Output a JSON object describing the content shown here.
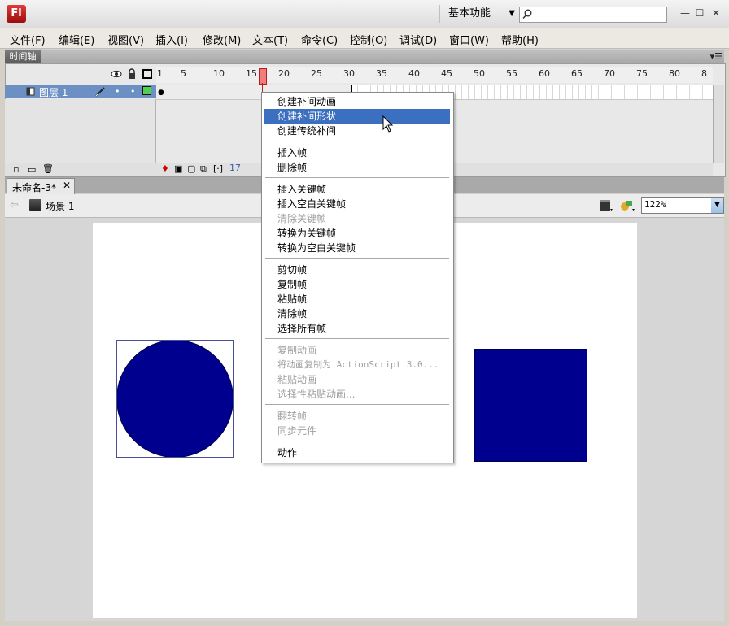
{
  "app": {
    "logo": "Fl",
    "workspace": "基本功能",
    "search_placeholder": ""
  },
  "menubar": [
    {
      "label": "文件(F)"
    },
    {
      "label": "编辑(E)"
    },
    {
      "label": "视图(V)"
    },
    {
      "label": "插入(I)"
    },
    {
      "label": "修改(M)"
    },
    {
      "label": "文本(T)"
    },
    {
      "label": "命令(C)"
    },
    {
      "label": "控制(O)"
    },
    {
      "label": "调试(D)"
    },
    {
      "label": "窗口(W)"
    },
    {
      "label": "帮助(H)"
    }
  ],
  "timeline": {
    "tab_label": "时间轴",
    "layer_name": "图层 1",
    "ruler_ticks": [
      "1",
      "5",
      "10",
      "15",
      "20",
      "25",
      "30",
      "35",
      "40",
      "45",
      "50",
      "55",
      "60",
      "65",
      "70",
      "75",
      "80",
      "8"
    ],
    "current_frame": "17",
    "playhead_frame": 17
  },
  "document": {
    "tab_title": "未命名-3*",
    "scene_label": "场景 1",
    "zoom": "122%"
  },
  "stage": {
    "fill_color": "#00008f",
    "background": "#ffffff"
  },
  "context_menu": {
    "groups": [
      [
        {
          "label": "创建补间动画",
          "enabled": true
        },
        {
          "label": "创建补间形状",
          "enabled": true,
          "highlighted": true
        },
        {
          "label": "创建传统补间",
          "enabled": true
        }
      ],
      [
        {
          "label": "插入帧",
          "enabled": true
        },
        {
          "label": "删除帧",
          "enabled": true
        }
      ],
      [
        {
          "label": "插入关键帧",
          "enabled": true
        },
        {
          "label": "插入空白关键帧",
          "enabled": true
        },
        {
          "label": "清除关键帧",
          "enabled": false
        },
        {
          "label": "转换为关键帧",
          "enabled": true
        },
        {
          "label": "转换为空白关键帧",
          "enabled": true
        }
      ],
      [
        {
          "label": "剪切帧",
          "enabled": true
        },
        {
          "label": "复制帧",
          "enabled": true
        },
        {
          "label": "粘贴帧",
          "enabled": true
        },
        {
          "label": "清除帧",
          "enabled": true
        },
        {
          "label": "选择所有帧",
          "enabled": true
        }
      ],
      [
        {
          "label": "复制动画",
          "enabled": false
        },
        {
          "label": "将动画复制为 ActionScript 3.0...",
          "enabled": false
        },
        {
          "label": "粘贴动画",
          "enabled": false
        },
        {
          "label": "选择性粘贴动画...",
          "enabled": false
        }
      ],
      [
        {
          "label": "翻转帧",
          "enabled": false
        },
        {
          "label": "同步元件",
          "enabled": false
        }
      ],
      [
        {
          "label": "动作",
          "enabled": true
        }
      ]
    ]
  }
}
